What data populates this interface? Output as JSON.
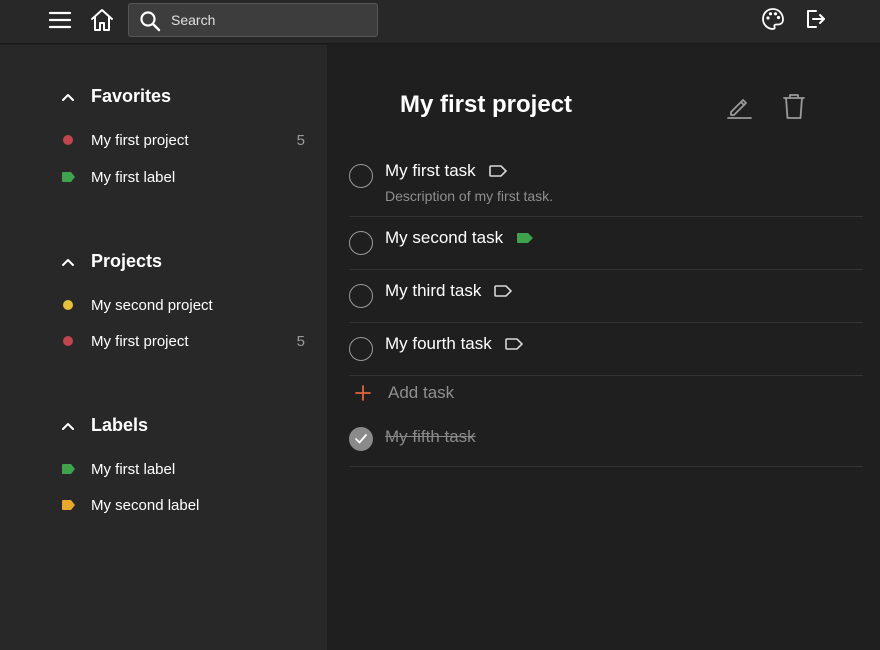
{
  "topbar": {
    "menu_icon": "hamburger-menu-icon",
    "home_icon": "home-icon",
    "search": {
      "icon": "search-icon",
      "placeholder": "Search",
      "value": ""
    },
    "theme_icon": "palette-icon",
    "logout_icon": "logout-icon"
  },
  "sidebar": {
    "favorites": {
      "title": "Favorites",
      "items": [
        {
          "label": "My first project",
          "count": "5",
          "kind": "project",
          "color": "#c0454f"
        },
        {
          "label": "My first label",
          "count": "",
          "kind": "label",
          "color": "#3fa34d"
        }
      ]
    },
    "projects": {
      "title": "Projects",
      "items": [
        {
          "label": "My second project",
          "count": "",
          "kind": "project",
          "color": "#e6c13b"
        },
        {
          "label": "My first project",
          "count": "5",
          "kind": "project",
          "color": "#c0454f"
        }
      ]
    },
    "labels": {
      "title": "Labels",
      "items": [
        {
          "label": "My first label",
          "kind": "label",
          "color": "#3fa34d"
        },
        {
          "label": "My second label",
          "kind": "label",
          "color": "#e6a92e"
        }
      ]
    }
  },
  "main": {
    "title": "My first project",
    "edit_icon": "pencil-icon",
    "delete_icon": "trash-icon",
    "tasks": [
      {
        "title": "My first task",
        "description": "Description of my first task.",
        "label_color": "none",
        "done": false
      },
      {
        "title": "My second task",
        "description": "",
        "label_color": "#3fa34d",
        "done": false
      },
      {
        "title": "My third task",
        "description": "",
        "label_color": "none",
        "done": false
      },
      {
        "title": "My fourth task",
        "description": "",
        "label_color": "none",
        "done": false
      }
    ],
    "add_task_label": "Add task",
    "completed_tasks": [
      {
        "title": "My fifth task",
        "done": true
      }
    ]
  },
  "colors": {
    "background": "#1f1f1f",
    "sidebar": "#282828",
    "accent_add": "#e0643f",
    "muted_text": "#8f8f8f"
  }
}
